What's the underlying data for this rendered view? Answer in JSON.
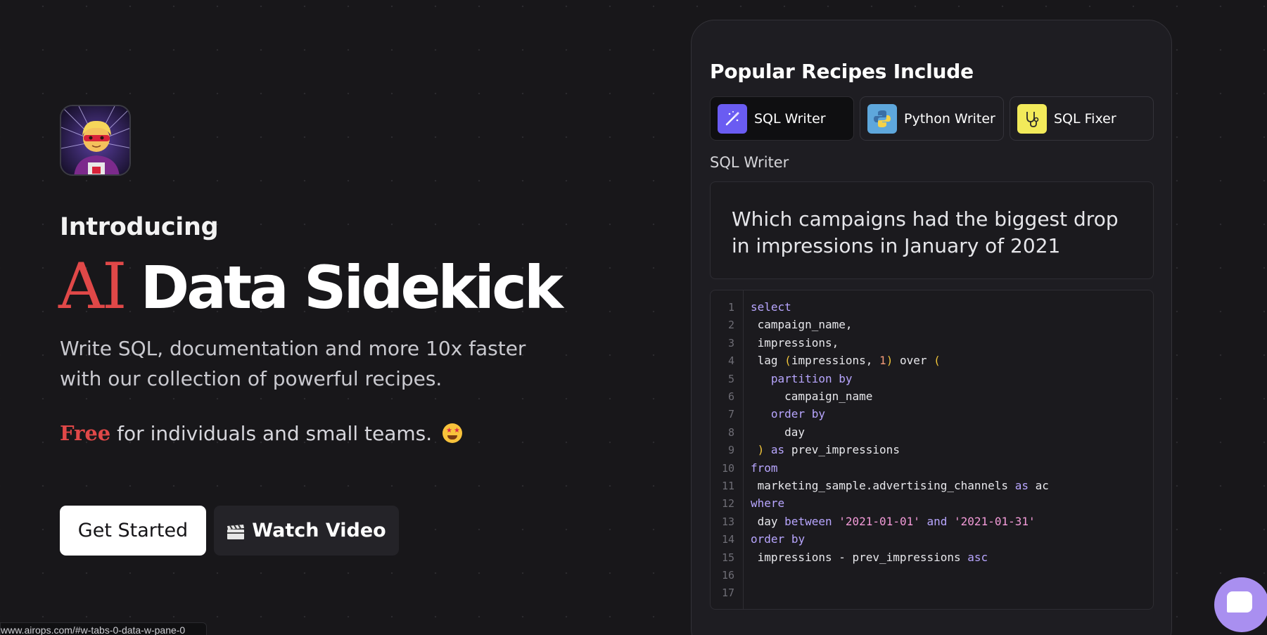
{
  "hero": {
    "intro": "Introducing",
    "headline_accent": "AI",
    "headline_main": "Data Sidekick",
    "subtitle": "Write SQL, documentation and more 10x faster with our collection of powerful recipes.",
    "free_word": "Free",
    "free_rest": " for individuals and small teams.",
    "get_started": "Get Started",
    "watch_video": "Watch Video"
  },
  "panel": {
    "title": "Popular Recipes Include",
    "tabs": [
      {
        "label": "SQL Writer",
        "icon": "magic-wand-icon",
        "color": "#6a5cf2"
      },
      {
        "label": "Python Writer",
        "icon": "python-icon",
        "color": "#5ea7dc"
      },
      {
        "label": "SQL Fixer",
        "icon": "stethoscope-icon",
        "color": "#f2ea5a"
      }
    ],
    "active_tab": "SQL Writer",
    "section_label": "SQL Writer",
    "prompt": "Which campaigns had the biggest drop in impressions in January of 2021",
    "code_lines": [
      "select",
      " campaign_name,",
      " impressions,",
      " lag (impressions, 1) over (",
      "   partition by",
      "     campaign_name",
      "   order by",
      "     day",
      " ) as prev_impressions",
      "from",
      " marketing_sample.advertising_channels as ac",
      "where",
      " day between '2021-01-01' and '2021-01-31'",
      "order by",
      " impressions - prev_impressions asc",
      "",
      ""
    ],
    "line_numbers": [
      "1",
      "2",
      "3",
      "4",
      "5",
      "6",
      "7",
      "8",
      "9",
      "10",
      "11",
      "12",
      "13",
      "14",
      "15",
      "16",
      "17"
    ]
  },
  "status_url": "www.airops.com/#w-tabs-0-data-w-pane-0",
  "colors": {
    "accent": "#e04848",
    "background": "#18171a",
    "keyword": "#b8a6ff",
    "paren": "#f0c43a",
    "string": "#f39bd8",
    "chat": "#a98ff0"
  }
}
